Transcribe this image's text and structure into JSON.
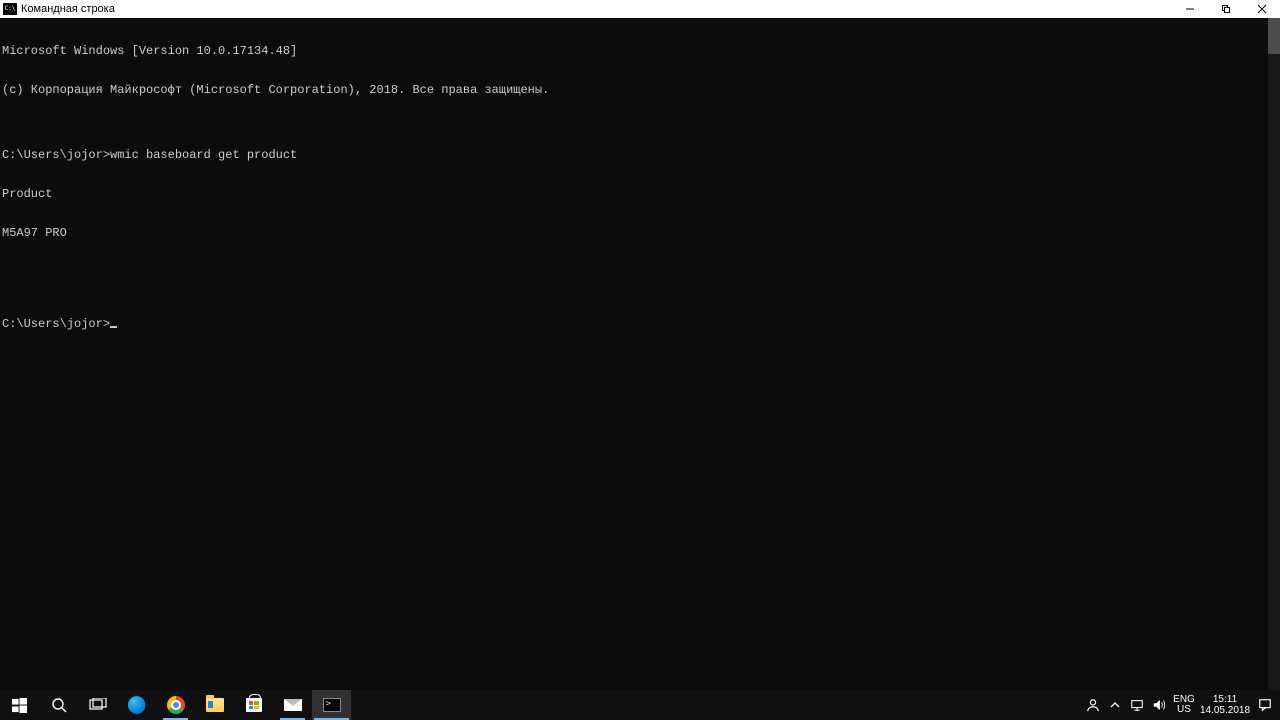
{
  "window": {
    "title": "Командная строка"
  },
  "terminal": {
    "lines": [
      "Microsoft Windows [Version 10.0.17134.48]",
      "(c) Корпорация Майкрософт (Microsoft Corporation), 2018. Все права защищены.",
      "",
      "C:\\Users\\jojor>wmic baseboard get product",
      "Product",
      "M5A97 PRO",
      "",
      ""
    ],
    "prompt": "C:\\Users\\jojor>"
  },
  "taskbar": {
    "items": [
      {
        "name": "start",
        "active": false
      },
      {
        "name": "search",
        "active": false
      },
      {
        "name": "task-view",
        "active": false
      },
      {
        "name": "edge",
        "active": false,
        "running": false
      },
      {
        "name": "chrome",
        "active": false,
        "running": true
      },
      {
        "name": "file-explorer",
        "active": false,
        "running": false
      },
      {
        "name": "store",
        "active": false,
        "running": false
      },
      {
        "name": "mail",
        "active": false,
        "running": true
      },
      {
        "name": "command-prompt",
        "active": true,
        "running": true
      }
    ]
  },
  "tray": {
    "language_primary": "ENG",
    "language_secondary": "US",
    "time": "15:11",
    "date": "14.05.2018"
  }
}
